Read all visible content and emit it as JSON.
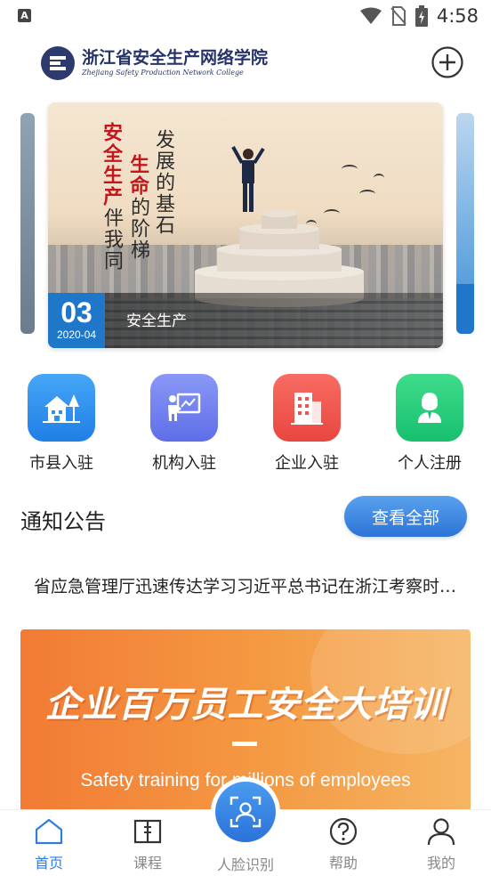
{
  "status_bar": {
    "time": "4:58",
    "left_badge": "A",
    "icons": [
      "wifi-icon",
      "no-sim-icon",
      "battery-charging-icon"
    ]
  },
  "header": {
    "logo_cn": "浙江省安全生产网络学院",
    "logo_en": "Zhejiang Safety Production Network College",
    "add_icon": "plus-circle-icon"
  },
  "carousel": {
    "active_slide": {
      "day": "03",
      "year_month": "2020-04",
      "caption": "安全生产",
      "headline_col1": [
        "安全生产",
        "伴我同"
      ],
      "headline_col2": [
        "生命",
        "的阶梯"
      ],
      "headline_col3": [
        "发展的基石"
      ]
    }
  },
  "entries": [
    {
      "label": "市县入驻",
      "icon": "house-tree-icon",
      "color": "#2f8ff0"
    },
    {
      "label": "机构入驻",
      "icon": "teacher-board-icon",
      "color": "#6f7ff0"
    },
    {
      "label": "企业入驻",
      "icon": "building-icon",
      "color": "#f2544f"
    },
    {
      "label": "个人注册",
      "icon": "person-icon",
      "color": "#2fcf7f"
    }
  ],
  "notice": {
    "title": "通知公告",
    "view_all": "查看全部",
    "items": [
      "省应急管理厅迅速传达学习习近平总书记在浙江考察时的重要讲话精神"
    ]
  },
  "promo": {
    "title": "企业百万员工安全大培训",
    "dash": "—",
    "subtitle": "Safety training for millions of employees"
  },
  "bottom_nav": {
    "items": [
      {
        "label": "首页",
        "icon": "home-icon",
        "active": true
      },
      {
        "label": "课程",
        "icon": "book-icon",
        "active": false
      },
      {
        "label": "人脸识别",
        "icon": "face-scan-icon",
        "active": false
      },
      {
        "label": "帮助",
        "icon": "question-circle-icon",
        "active": false
      },
      {
        "label": "我的",
        "icon": "user-icon",
        "active": false
      }
    ]
  },
  "colors": {
    "primary_blue": "#2f7de1",
    "date_blue": "#1f77c9",
    "logo_navy": "#26336a",
    "promo_orange": "#f27b34"
  }
}
